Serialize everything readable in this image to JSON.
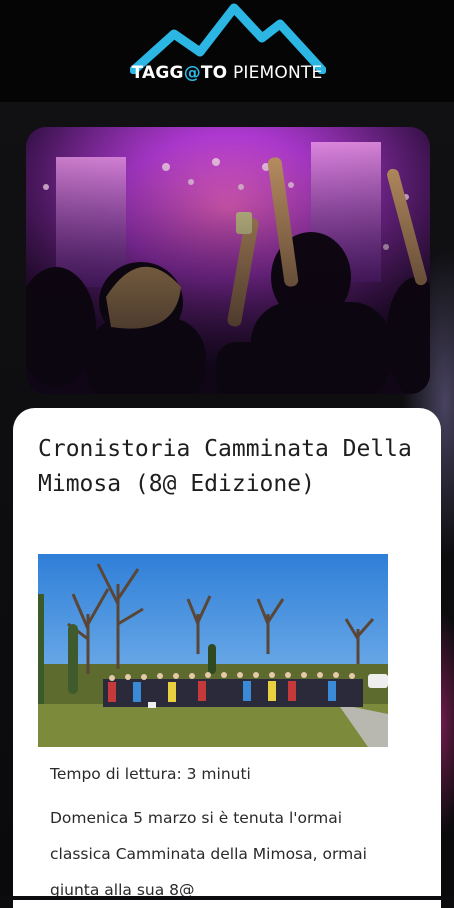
{
  "header": {
    "logo_name_part1": "TAGG",
    "logo_at": "@",
    "logo_name_part2": "TO",
    "logo_region": "PIEMONTE"
  },
  "hero": {
    "image": "concert-crowd-photo"
  },
  "article": {
    "title": "Cronistoria Camminata Della Mimosa (8@ Edizione)",
    "photo": "group-hike-photo",
    "reading_time": "Tempo di lettura: 3 minuti",
    "body": "Domenica 5 marzo si è tenuta l'ormai classica Camminata della Mimosa, ormai giunta alla sua 8@"
  },
  "colors": {
    "brand_cyan": "#2bb6e3",
    "header_bg": "#050505",
    "card_bg": "#ffffff"
  }
}
